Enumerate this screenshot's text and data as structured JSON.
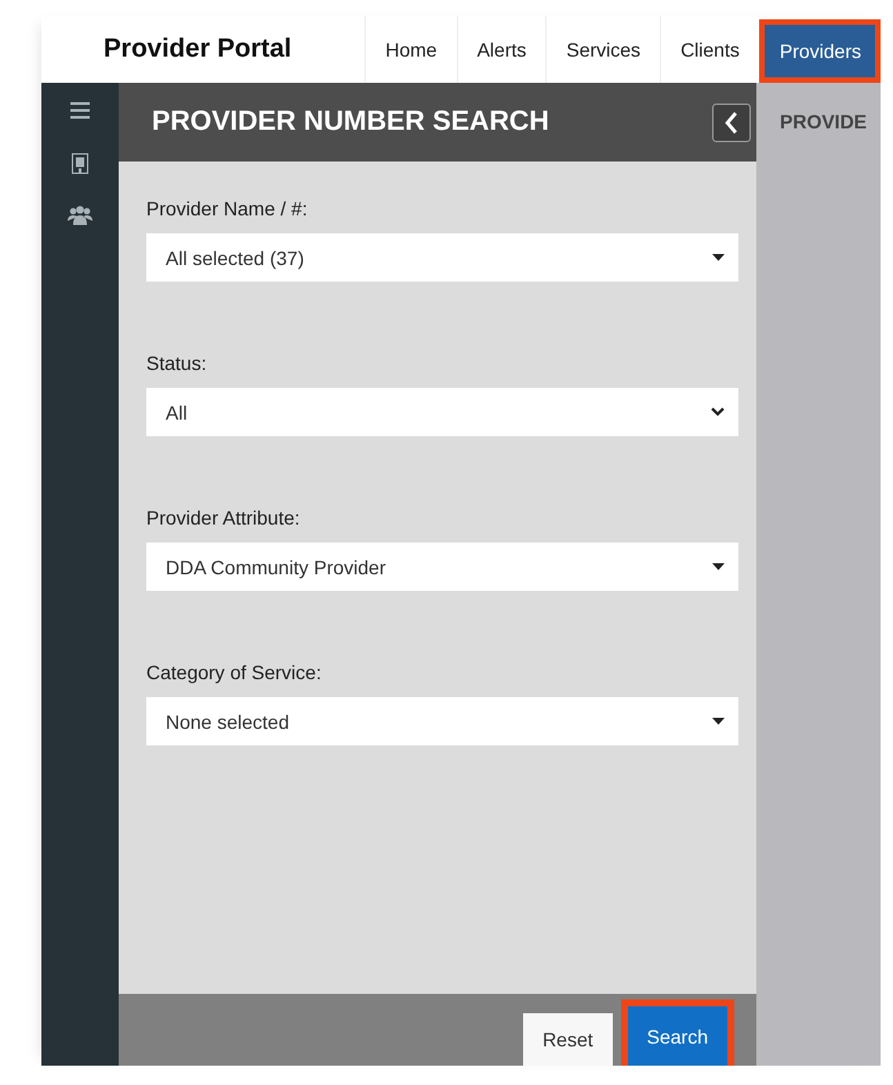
{
  "header": {
    "title": "Provider Portal",
    "nav": [
      {
        "label": "Home",
        "selected": false,
        "highlighted": false
      },
      {
        "label": "Alerts",
        "selected": false,
        "highlighted": false
      },
      {
        "label": "Services",
        "selected": false,
        "highlighted": false
      },
      {
        "label": "Clients",
        "selected": false,
        "highlighted": false
      },
      {
        "label": "Providers",
        "selected": true,
        "highlighted": true
      }
    ]
  },
  "sidebar": {
    "items": [
      {
        "kind": "menu"
      },
      {
        "kind": "building"
      },
      {
        "kind": "users"
      }
    ]
  },
  "panel": {
    "title": "PROVIDER NUMBER SEARCH",
    "fields": [
      {
        "label": "Provider Name / #:",
        "value": "All selected (37)",
        "kind": "multiselect"
      },
      {
        "label": "Status:",
        "value": "All",
        "kind": "select"
      },
      {
        "label": "Provider Attribute:",
        "value": "DDA Community Provider",
        "kind": "multiselect"
      },
      {
        "label": "Category of Service:",
        "value": "None selected",
        "kind": "multiselect"
      }
    ],
    "buttons": [
      {
        "label": "Reset",
        "kind": "secondary",
        "highlighted": false
      },
      {
        "label": "Search",
        "kind": "primary",
        "highlighted": true
      }
    ]
  },
  "right_pane": {
    "title": "PROVIDE"
  }
}
